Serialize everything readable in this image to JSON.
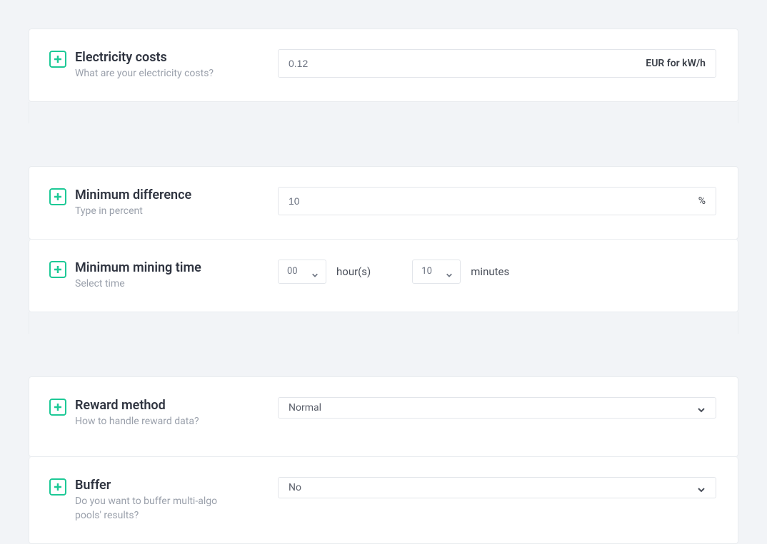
{
  "electricity": {
    "title": "Electricity costs",
    "sub": "What are your electricity costs?",
    "value": "0.12",
    "unit": "EUR for kW/h"
  },
  "min_diff": {
    "title": "Minimum difference",
    "sub": "Type in percent",
    "value": "10",
    "unit": "%"
  },
  "min_time": {
    "title": "Minimum mining time",
    "sub": "Select time",
    "hours": "00",
    "hours_label": "hour(s)",
    "minutes": "10",
    "minutes_label": "minutes"
  },
  "reward": {
    "title": "Reward method",
    "sub": "How to handle reward data?",
    "value": "Normal"
  },
  "buffer": {
    "title": "Buffer",
    "sub": "Do you want to buffer multi-algo pools' results?",
    "value": "No"
  }
}
